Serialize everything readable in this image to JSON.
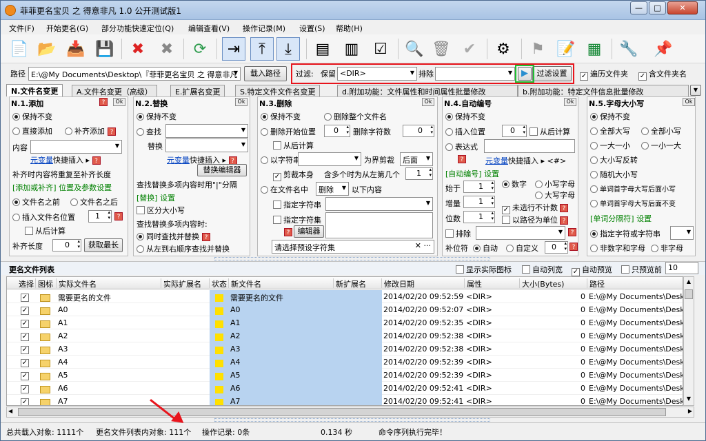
{
  "title": "菲菲更名宝贝 之 得意非凡 1.0 公开测试版1",
  "menu": [
    "文件(F)",
    "开始更名(G)",
    "部分功能快速定位(Q)",
    "编辑查看(V)",
    "操作记录(M)",
    "设置(S)",
    "帮助(H)"
  ],
  "path": {
    "label": "路径",
    "value": "E:\\@My Documents\\Desktop\\『菲菲更名宝贝 之 得意非凡",
    "load_button": "载入路径"
  },
  "filter": {
    "label": "过滤:",
    "keep_label": "保留",
    "keep_value": "<DIR>",
    "exclude_label": "排除",
    "exclude_value": "",
    "settings_button": "过滤设置",
    "traverse": "遍历文件夹",
    "include_folder": "含文件夹名"
  },
  "tabs": [
    "N.文件名变更",
    "A.文件名变更（高级）",
    "E.扩展名变更",
    "S.特定文件文件名变更",
    "d.附加功能：文件属性和时间属性批量修改",
    "b.附加功能：特定文件信息批量修改"
  ],
  "p1": {
    "title": "N.1.添加",
    "ok": "Ok",
    "keep": "保持不变",
    "direct": "直接添加",
    "pad": "补齐添加",
    "content": "内容",
    "insert_link": "元变量",
    "insert_text": "快捷插入",
    "pad_note": "补齐时内容将重复至补齐长度",
    "pos_params": "[添加或补齐] 位置及参数设置",
    "before": "文件名之前",
    "after": "文件名之后",
    "insert_pos": "插入文件名位置",
    "insert_pos_val": "1",
    "from_end": "从后计算",
    "pad_len": "补齐长度",
    "pad_len_val": "0",
    "get_longest": "获取最长"
  },
  "p2": {
    "title": "N.2.替换",
    "ok": "Ok",
    "keep": "保持不变",
    "find": "查找",
    "replace": "替换",
    "insert_link": "元变量",
    "insert_text": "快捷插入",
    "editor": "替换编辑器",
    "multi_note": "查找替换多项内容时用\"|\"分隔",
    "settings": "[替换] 设置",
    "case": "区分大小写",
    "multi_title": "查找替换多项内容时:",
    "simul": "同时查找并替换",
    "ltr": "从左到右顺序查找并替换"
  },
  "p3": {
    "title": "N.3.删除",
    "ok": "Ok",
    "keep": "保持不变",
    "del_all": "删除整个文件名",
    "del_start": "删除开始位置",
    "del_start_val": "0",
    "del_count": "删除字符数",
    "del_count_val": "0",
    "from_end": "从后计算",
    "by_str": "以字符串",
    "boundary": "为界剪裁",
    "after_opt": "后面",
    "cut_self": "剪裁本身",
    "multi_left": "含多个时为从左第几个",
    "multi_left_val": "1",
    "in_name": "在文件名中",
    "delete_opt": "删除",
    "following": "以下内容",
    "spec_str": "指定字符串",
    "spec_set": "指定字符集",
    "editor": "编辑器",
    "preset": "请选择预设字符集"
  },
  "p4": {
    "title": "N.4.自动编号",
    "ok": "Ok",
    "keep": "保持不变",
    "insert_pos": "插入位置",
    "insert_pos_val": "0",
    "from_end": "从后计算",
    "expr": "表达式",
    "insert_link": "元变量",
    "insert_text": "快捷插入",
    "tag": "<#>",
    "settings": "[自动编号] 设置",
    "start": "始于",
    "start_val": "1",
    "number": "数字",
    "lower": "小写字母",
    "upper": "大写字母",
    "step": "增量",
    "step_val": "1",
    "no_count": "未选行不计数",
    "digits": "位数",
    "digits_val": "1",
    "by_path": "以路径为单位",
    "exclude": "排除",
    "pad_char": "补位符",
    "auto": "自动",
    "custom": "自定义",
    "custom_val": "0"
  },
  "p5": {
    "title": "N.5.字母大小写",
    "ok": "Ok",
    "keep": "保持不变",
    "all_upper": "全部大写",
    "all_lower": "全部小写",
    "one_upper": "一大一小",
    "one_lower": "一小一大",
    "invert": "大小写反转",
    "random": "随机大小写",
    "word_upper_lower": "单词首字母大写后面小写",
    "word_upper_keep": "单词首字母大写后面不变",
    "sep_settings": "[单词分隔符] 设置",
    "spec_chars": "指定字符或字符串",
    "non_num": "非数字和字母",
    "non_char": "非字母"
  },
  "list": {
    "title": "更名文件列表",
    "show_icon": "显示实际图标",
    "auto_width": "自动列宽",
    "auto_preview": "自动预览",
    "preview_only": "只预览前",
    "preview_count": "10",
    "columns": [
      "选择",
      "图标",
      "实际文件名",
      "实际扩展名",
      "状态",
      "新文件名",
      "新扩展名",
      "修改日期",
      "属性",
      "大小(Bytes)",
      "路径"
    ],
    "rows": [
      {
        "name": "需要更名的文件",
        "newname": "需要更名的文件",
        "date": "2014/02/20 09:52:59",
        "attr": "<DIR>",
        "size": "0",
        "path": "E:\\@My Documents\\Desktop"
      },
      {
        "name": "A0",
        "newname": "A0",
        "date": "2014/02/20 09:52:07",
        "attr": "<DIR>",
        "size": "0",
        "path": "E:\\@My Documents\\Desktop"
      },
      {
        "name": "A1",
        "newname": "A1",
        "date": "2014/02/20 09:52:35",
        "attr": "<DIR>",
        "size": "0",
        "path": "E:\\@My Documents\\Desktop"
      },
      {
        "name": "A2",
        "newname": "A2",
        "date": "2014/02/20 09:52:38",
        "attr": "<DIR>",
        "size": "0",
        "path": "E:\\@My Documents\\Desktop"
      },
      {
        "name": "A3",
        "newname": "A3",
        "date": "2014/02/20 09:52:38",
        "attr": "<DIR>",
        "size": "0",
        "path": "E:\\@My Documents\\Desktop"
      },
      {
        "name": "A4",
        "newname": "A4",
        "date": "2014/02/20 09:52:39",
        "attr": "<DIR>",
        "size": "0",
        "path": "E:\\@My Documents\\Desktop"
      },
      {
        "name": "A5",
        "newname": "A5",
        "date": "2014/02/20 09:52:39",
        "attr": "<DIR>",
        "size": "0",
        "path": "E:\\@My Documents\\Desktop"
      },
      {
        "name": "A6",
        "newname": "A6",
        "date": "2014/02/20 09:52:41",
        "attr": "<DIR>",
        "size": "0",
        "path": "E:\\@My Documents\\Desktop"
      },
      {
        "name": "A7",
        "newname": "A7",
        "date": "2014/02/20 09:52:41",
        "attr": "<DIR>",
        "size": "0",
        "path": "E:\\@My Documents\\Desktop"
      }
    ]
  },
  "status": {
    "total": "总共载入对象: 1111个",
    "in_list": "更名文件列表内对象: 111个",
    "records": "操作记录: 0条",
    "time": "0.134 秒",
    "message": "命令序列执行完毕！"
  },
  "colors": {
    "highlight": "#b8d3f0",
    "annotation": "#e8141c",
    "green_box": "#1fbf32"
  }
}
